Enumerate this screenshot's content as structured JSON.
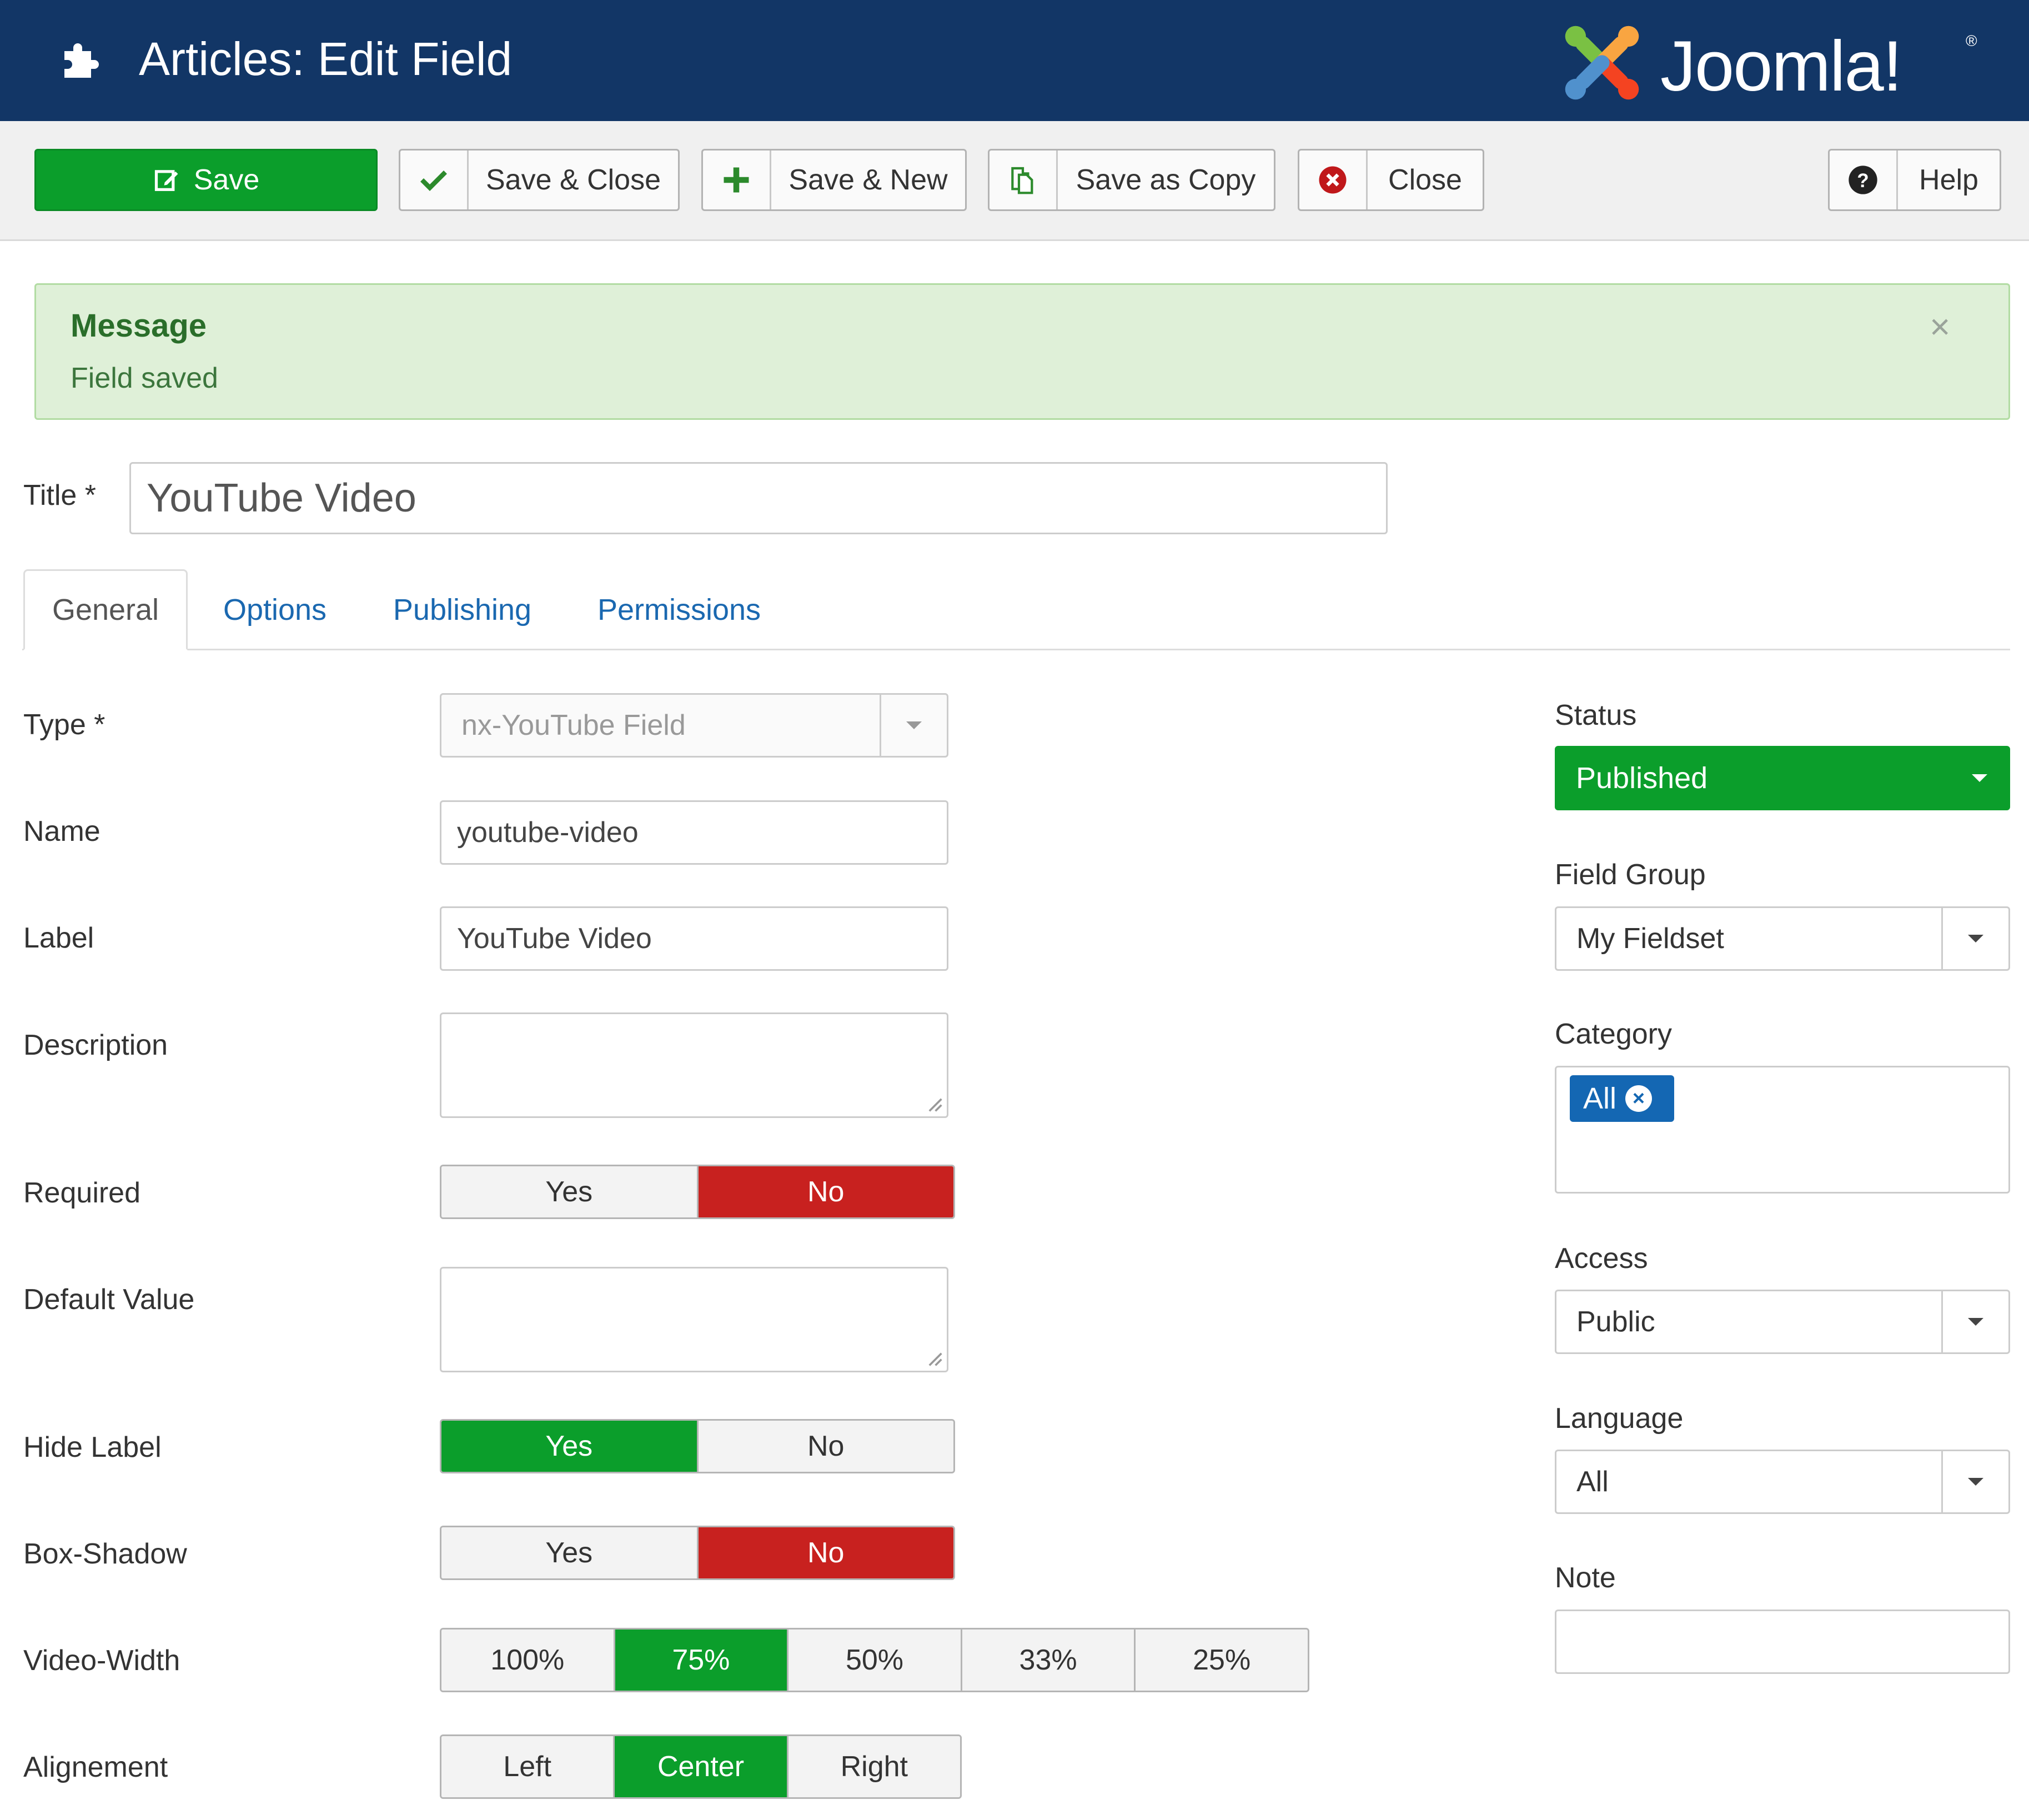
{
  "header": {
    "title": "Articles: Edit Field",
    "puzzle_icon": "puzzle-piece-icon",
    "brand": "Joomla!",
    "brand_word": "Joomla!",
    "registered_mark": "®",
    "brand_colors": [
      "#f9a541",
      "#f44321",
      "#5091cd",
      "#7ac143"
    ],
    "background_color": "#123666"
  },
  "toolbar": {
    "save_label": "Save",
    "save_close_label": "Save & Close",
    "save_new_label": "Save & New",
    "save_copy_label": "Save as Copy",
    "close_label": "Close",
    "help_label": "Help",
    "icons": {
      "save": "edit-icon",
      "save_close": "checkmark-icon",
      "save_new": "plus-icon",
      "save_copy": "copy-icon",
      "close": "cancel-circle-icon",
      "help": "question-circle-icon"
    }
  },
  "message": {
    "heading": "Message",
    "body": "Field saved",
    "close": "×"
  },
  "title_field": {
    "label": "Title *",
    "value": "YouTube Video"
  },
  "tabs": [
    {
      "label": "General",
      "active": true
    },
    {
      "label": "Options",
      "active": false
    },
    {
      "label": "Publishing",
      "active": false
    },
    {
      "label": "Permissions",
      "active": false
    }
  ],
  "general": {
    "type": {
      "label": "Type *",
      "value": "nx-YouTube Field"
    },
    "name": {
      "label": "Name",
      "value": "youtube-video"
    },
    "field_label": {
      "label": "Label",
      "value": "YouTube Video"
    },
    "description": {
      "label": "Description",
      "value": ""
    },
    "required": {
      "label": "Required",
      "options": [
        "Yes",
        "No"
      ],
      "selected": "No"
    },
    "default_value": {
      "label": "Default Value",
      "value": ""
    },
    "hide_label": {
      "label": "Hide Label",
      "options": [
        "Yes",
        "No"
      ],
      "selected": "Yes"
    },
    "box_shadow": {
      "label": "Box-Shadow",
      "options": [
        "Yes",
        "No"
      ],
      "selected": "No"
    },
    "video_width": {
      "label": "Video-Width",
      "options": [
        "100%",
        "75%",
        "50%",
        "33%",
        "25%"
      ],
      "selected": "75%"
    },
    "alignment": {
      "label": "Alignement",
      "options": [
        "Left",
        "Center",
        "Right"
      ],
      "selected": "Center"
    }
  },
  "sidebar": {
    "status": {
      "label": "Status",
      "value": "Published"
    },
    "field_group": {
      "label": "Field Group",
      "value": "My Fieldset"
    },
    "category": {
      "label": "Category",
      "chip": "All"
    },
    "access": {
      "label": "Access",
      "value": "Public"
    },
    "language": {
      "label": "Language",
      "value": "All"
    },
    "note": {
      "label": "Note",
      "value": ""
    }
  },
  "colors": {
    "success_green": "#0b9e2b",
    "danger_red": "#c8211f",
    "link_blue": "#1a68b0",
    "chip_blue": "#1467b3",
    "message_bg": "#dff0d8"
  }
}
